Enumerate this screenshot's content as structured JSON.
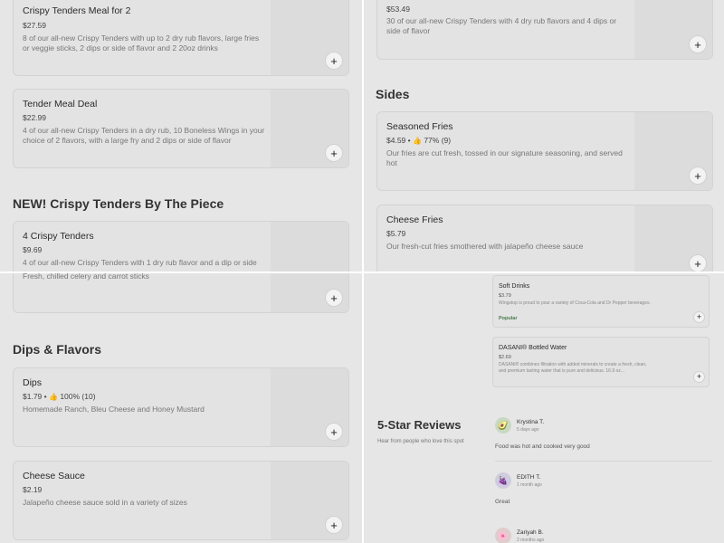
{
  "top_left": {
    "cards": [
      {
        "title": "Crispy Tenders Meal for 2",
        "price": "$27.59",
        "desc": "8 of our all-new Crispy Tenders with up to 2 dry rub flavors, large fries or veggie sticks, 2 dips or side of flavor and 2 20oz drinks"
      },
      {
        "title": "Tender Meal Deal",
        "price": "$22.99",
        "desc": "4 of our all-new Crispy Tenders in a dry rub, 10 Boneless Wings in your choice of 2 flavors, with a large fry and 2 dips or side of flavor"
      }
    ],
    "section": "NEW! Crispy Tenders By The Piece",
    "card3": {
      "title": "4 Crispy Tenders",
      "price": "$9.69",
      "desc": "4 of our all-new Crispy Tenders with 1 dry rub flavor and a dip or side"
    }
  },
  "top_right": {
    "card1": {
      "price": "$53.49",
      "desc": "30 of our all-new Crispy Tenders with 4 dry rub flavors and 4 dips or side of flavor"
    },
    "section": "Sides",
    "card2": {
      "title": "Seasoned Fries",
      "price": "$4.59 •",
      "rating": "77% (9)",
      "desc": "Our fries are cut fresh, tossed in our signature seasoning, and served hot"
    },
    "card3": {
      "title": "Cheese Fries",
      "price": "$5.79",
      "desc": "Our fresh-cut fries smothered with jalapeño cheese sauce"
    }
  },
  "bottom_left": {
    "card1_desc": "Fresh, chilled celery and carrot sticks",
    "section": "Dips & Flavors",
    "card2": {
      "title": "Dips",
      "price": "$1.79 •",
      "rating": "100% (10)",
      "desc": "Homemade Ranch, Bleu Cheese and Honey Mustard"
    },
    "card3": {
      "title": "Cheese Sauce",
      "price": "$2.19",
      "desc": "Jalapeño cheese sauce sold in a variety of sizes"
    }
  },
  "bottom_right": {
    "card1": {
      "title": "Soft Drinks",
      "price": "$3.79",
      "desc": "Wingstop is proud to pour a variety of Coca-Cola and Dr Pepper beverages.",
      "badge": "Popular"
    },
    "card2": {
      "title": "DASANI® Bottled Water",
      "price": "$2.69",
      "desc": "DASANI® combines filtration with added minerals to create a fresh, clean, and premium tasting water that is pure and delicious. 16.9 oz..."
    },
    "reviews_title": "5-Star Reviews",
    "reviews_sub": "Hear from people who love this spot",
    "reviews": [
      {
        "name": "Krystina T.",
        "date": "5 days ago",
        "text": "Food was hot and cooked very good"
      },
      {
        "name": "EDITH T.",
        "date": "1 month ago",
        "text": "Great"
      },
      {
        "name": "Zariyah B.",
        "date": "2 months ago",
        "text": ""
      }
    ]
  },
  "icons": {
    "add": "+",
    "thumb": "👍",
    "avatar1": "🥑",
    "avatar2": "🍇",
    "avatar3": "🌸"
  }
}
